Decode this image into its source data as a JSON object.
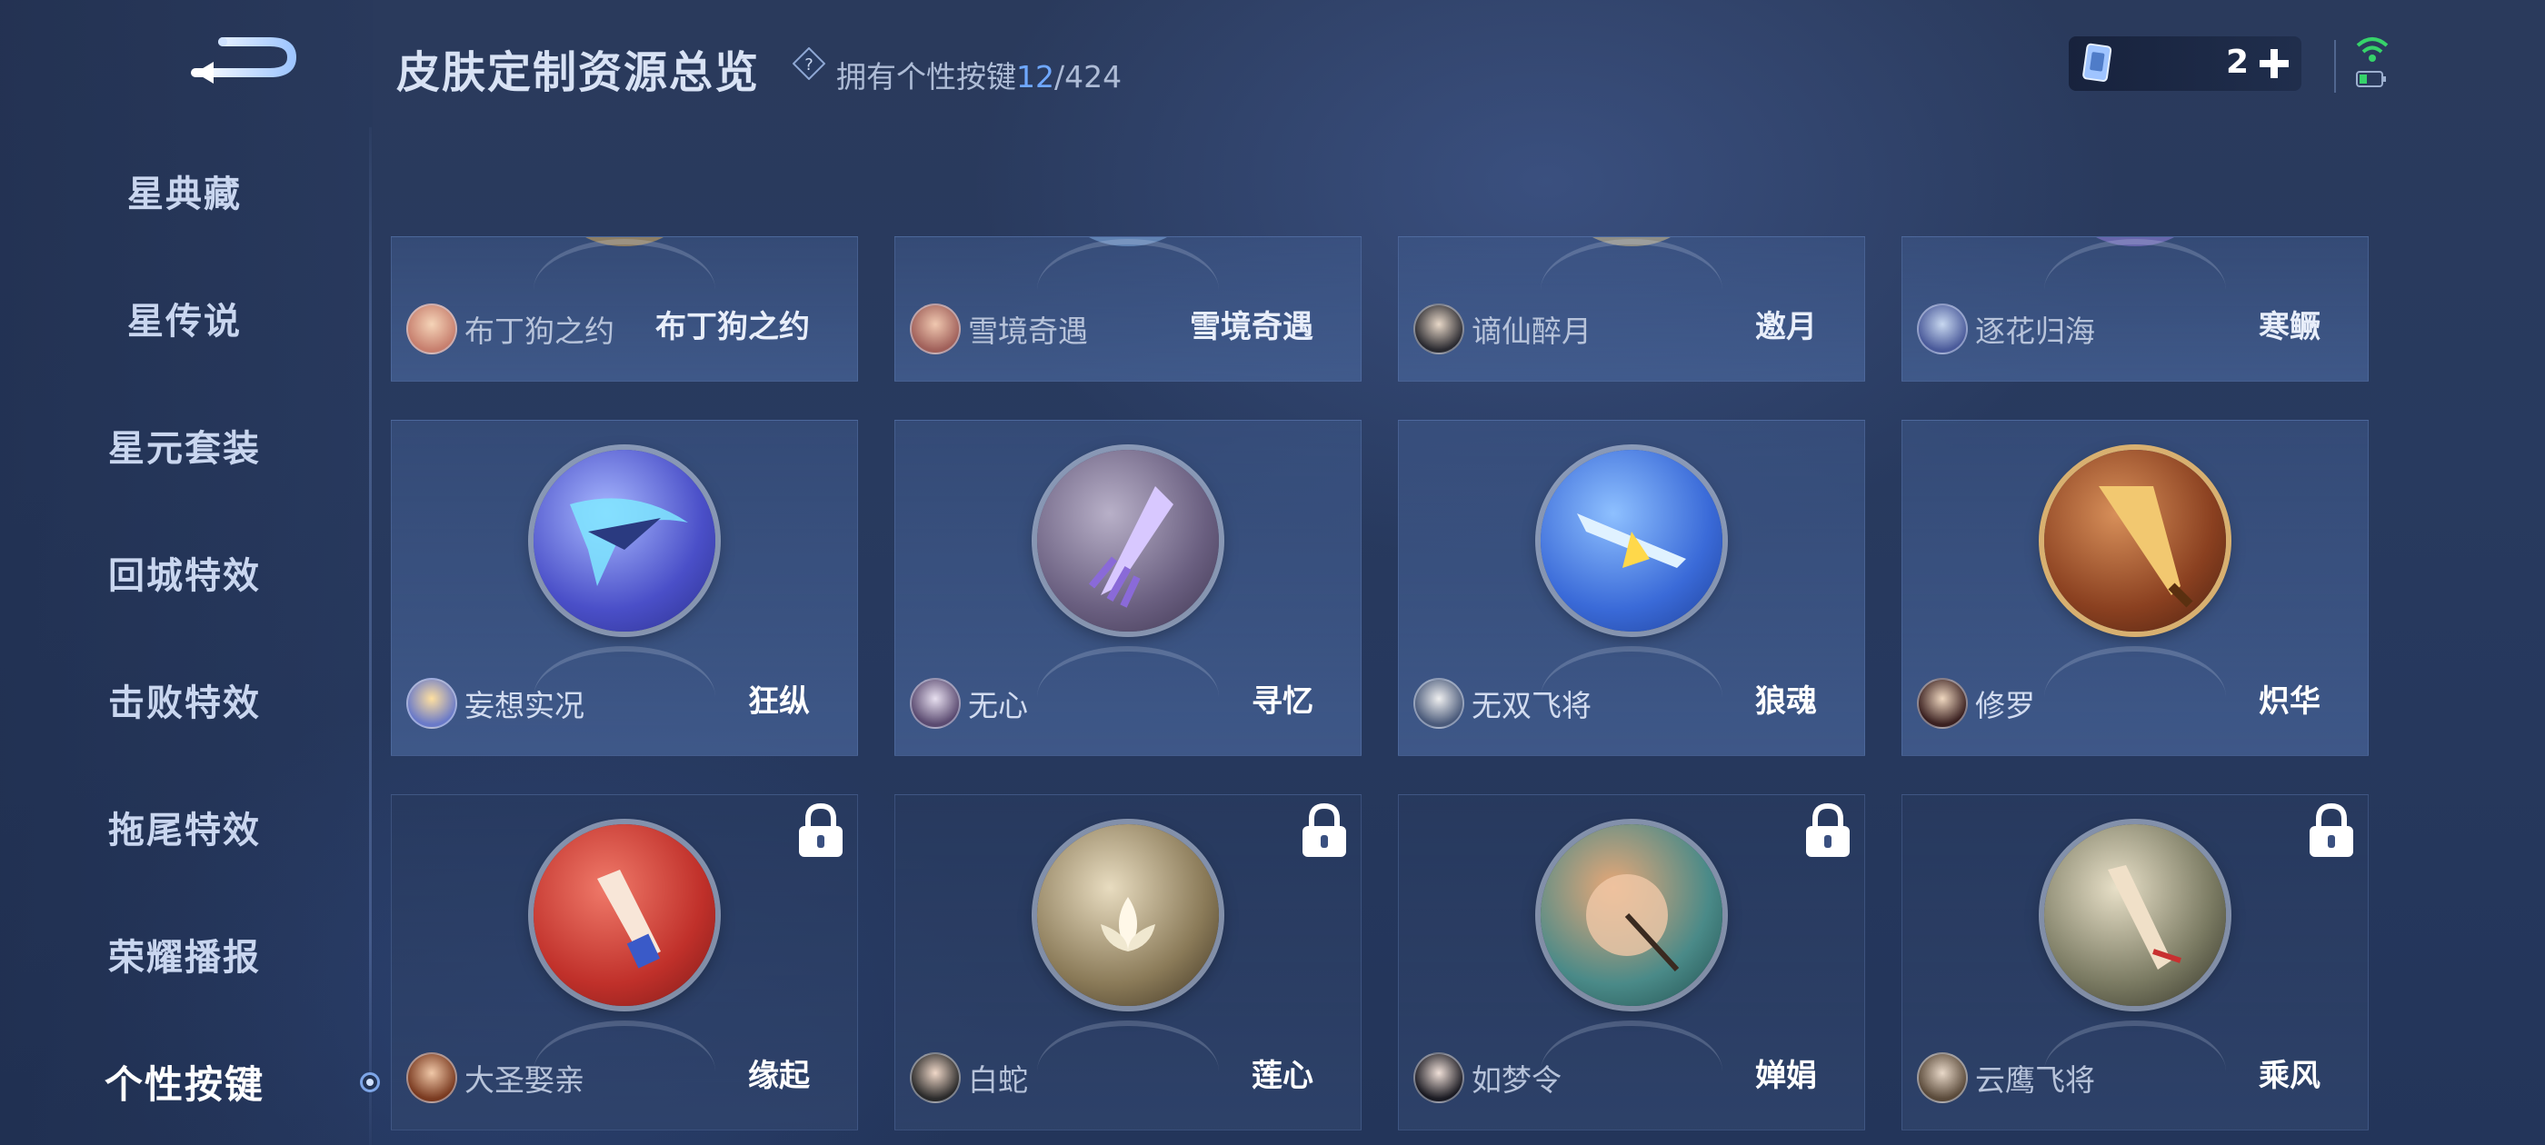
{
  "header": {
    "title": "皮肤定制资源总览",
    "owned_prefix": "拥有个性按键",
    "owned_count": "12",
    "owned_total": "/424"
  },
  "currency": {
    "value": "2"
  },
  "sidebar": {
    "items": [
      {
        "label": "星典藏"
      },
      {
        "label": "星传说"
      },
      {
        "label": "星元套装"
      },
      {
        "label": "回城特效"
      },
      {
        "label": "击败特效"
      },
      {
        "label": "拖尾特效"
      },
      {
        "label": "荣耀播报"
      },
      {
        "label": "个性按键",
        "active": true
      }
    ]
  },
  "grid": {
    "row0": [
      {
        "hero": "布丁狗之约",
        "skin": "布丁狗之约",
        "emblem_color": "#c9a25a"
      },
      {
        "hero": "雪境奇遇",
        "skin": "雪境奇遇",
        "emblem_color": "#7da7d8"
      },
      {
        "hero": "谪仙醉月",
        "skin": "邀月",
        "emblem_color": "#c8b88a"
      },
      {
        "hero": "逐花归海",
        "skin": "寒鳜",
        "emblem_color": "#8a7ad0"
      }
    ],
    "row1": [
      {
        "hero": "妄想实况",
        "skin": "狂纵",
        "emblem_color": "#5a6fd8",
        "locked": false
      },
      {
        "hero": "无心",
        "skin": "寻忆",
        "emblem_color": "#7b6a9a",
        "locked": false
      },
      {
        "hero": "无双飞将",
        "skin": "狼魂",
        "emblem_color": "#3f7ae0",
        "locked": false
      },
      {
        "hero": "修罗",
        "skin": "炽华",
        "emblem_color": "#a2582e",
        "locked": false
      }
    ],
    "row2": [
      {
        "hero": "大圣娶亲",
        "skin": "缘起",
        "emblem_color": "#c8372e",
        "locked": true
      },
      {
        "hero": "白蛇",
        "skin": "莲心",
        "emblem_color": "#8a7c5a",
        "locked": true
      },
      {
        "hero": "如梦令",
        "skin": "婵娟",
        "emblem_color": "#3f8c8a",
        "locked": true
      },
      {
        "hero": "云鹰飞将",
        "skin": "乘风",
        "emblem_color": "#8a8a72",
        "locked": true
      }
    ]
  }
}
